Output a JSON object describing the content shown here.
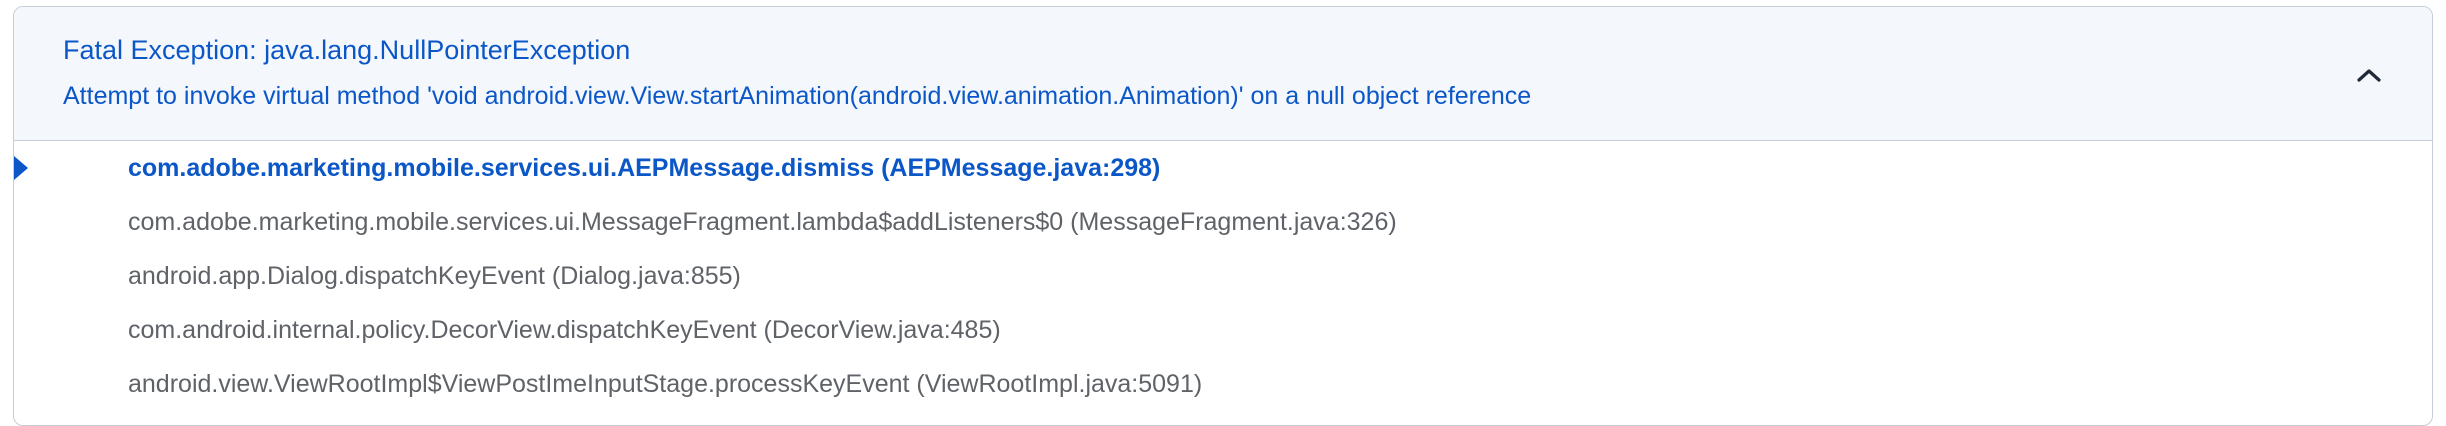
{
  "exception": {
    "title": "Fatal Exception: java.lang.NullPointerException",
    "message": "Attempt to invoke virtual method 'void android.view.View.startAnimation(android.view.animation.Animation)' on a null object reference",
    "collapse_icon": "chevron-up-icon"
  },
  "stack_frames": [
    "com.adobe.marketing.mobile.services.ui.AEPMessage.dismiss (AEPMessage.java:298)",
    "com.adobe.marketing.mobile.services.ui.MessageFragment.lambda$addListeners$0 (MessageFragment.java:326)",
    "android.app.Dialog.dispatchKeyEvent (Dialog.java:855)",
    "com.android.internal.policy.DecorView.dispatchKeyEvent (DecorView.java:485)",
    "android.view.ViewRootImpl$ViewPostImeInputStage.processKeyEvent (ViewRootImpl.java:5091)"
  ],
  "colors": {
    "accent": "#0b57c8",
    "frame_text": "#5f6368",
    "header_bg": "#f4f7fb",
    "border": "#c7cdd6"
  }
}
